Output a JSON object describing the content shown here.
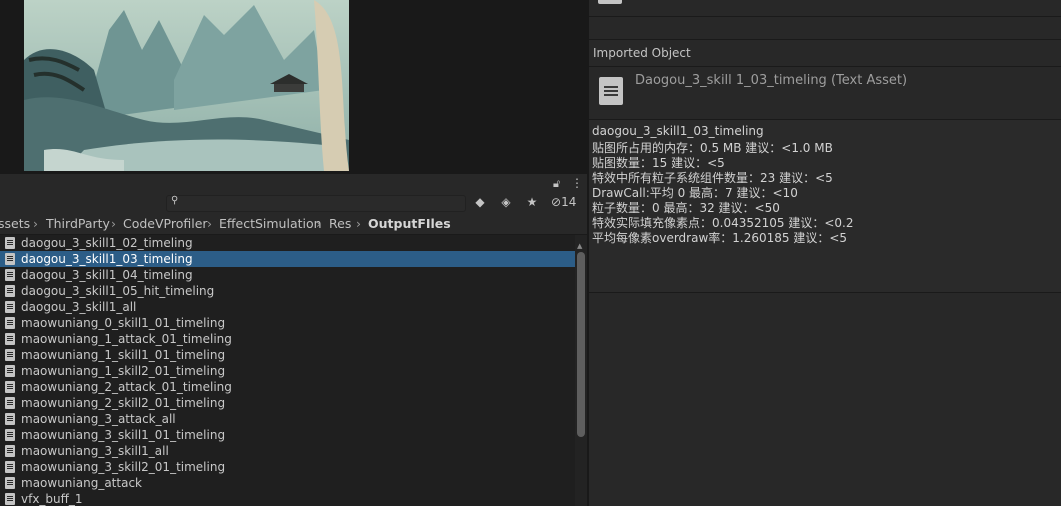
{
  "project": {
    "hidden_count": "14",
    "breadcrumb": [
      "ssets",
      "ThirdParty",
      "CodeVProfiler",
      "EffectSimulation",
      "Res",
      "OutputFIles"
    ],
    "files": [
      "daogou_3_skill1_02_timeling",
      "daogou_3_skill1_03_timeling",
      "daogou_3_skill1_04_timeling",
      "daogou_3_skill1_05_hit_timeling",
      "daogou_3_skill1_all",
      "maowuniang_0_skill1_01_timeling",
      "maowuniang_1_attack_01_timeling",
      "maowuniang_1_skill1_01_timeling",
      "maowuniang_1_skill2_01_timeling",
      "maowuniang_2_attack_01_timeling",
      "maowuniang_2_skill2_01_timeling",
      "maowuniang_3_attack_all",
      "maowuniang_3_skill1_01_timeling",
      "maowuniang_3_skill1_all",
      "maowuniang_3_skill2_01_timeling",
      "maowuniang_attack",
      "vfx_buff_1"
    ],
    "selected_file": "daogou_3_skill1_03_timeling"
  },
  "inspector": {
    "section_title": "Imported Object",
    "object_title": "Daogou_3_skill 1_03_timeling (Text Asset)",
    "text_lines": [
      "daogou_3_skill1_03_timeling",
      "贴图所占用的内存：0.5 MB   建议：<1.0 MB",
      "贴图数量：15    建议：<5",
      "特效中所有粒子系统组件数量：23    建议：<5",
      "DrawCall:平均 0    最高：7   建议：<10",
      "粒子数量：0   最高：32   建议：<50",
      "特效实际填充像素点：0.04352105   建议：<0.2",
      "平均每像素overdraw率：1.260185   建议：<5"
    ]
  },
  "icons": [
    "search-icon",
    "lock-icon",
    "menu-icon",
    "filter-type-icon",
    "label-icon",
    "favorite-icon",
    "eye-hidden-icon",
    "text-asset-icon"
  ],
  "colors": {
    "selection": "#2c5d87",
    "panel": "#282828",
    "list_bg": "#1f1f1f"
  }
}
